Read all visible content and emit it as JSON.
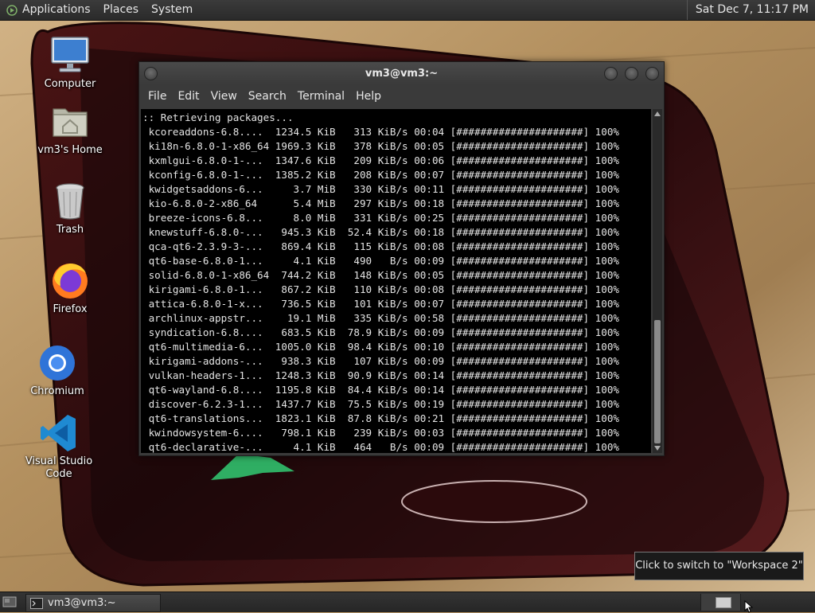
{
  "top_panel": {
    "menus": [
      "Applications",
      "Places",
      "System"
    ],
    "clock": "Sat Dec  7, 11:17 PM"
  },
  "desktop_icons": [
    {
      "label": "Computer",
      "icon": "computer-icon"
    },
    {
      "label": "vm3's Home",
      "icon": "home-folder-icon"
    },
    {
      "label": "Trash",
      "icon": "trash-icon"
    },
    {
      "label": "Firefox",
      "icon": "firefox-icon"
    },
    {
      "label": "Chromium",
      "icon": "chromium-icon"
    },
    {
      "label": "Visual Studio Code",
      "icon": "vscode-icon"
    }
  ],
  "terminal": {
    "title": "vm3@vm3:~",
    "menu": [
      "File",
      "Edit",
      "View",
      "Search",
      "Terminal",
      "Help"
    ],
    "header_line": ":: Retrieving packages...",
    "rows": [
      {
        "name": "kcoreaddons-6.8....",
        "size": "1234.5 KiB",
        "rate": "313 KiB/s",
        "time": "00:04",
        "progress": 100
      },
      {
        "name": "ki18n-6.8.0-1-x86_64",
        "size": "1969.3 KiB",
        "rate": "378 KiB/s",
        "time": "00:05",
        "progress": 100
      },
      {
        "name": "kxmlgui-6.8.0-1-...",
        "size": "1347.6 KiB",
        "rate": "209 KiB/s",
        "time": "00:06",
        "progress": 100
      },
      {
        "name": "kconfig-6.8.0-1-...",
        "size": "1385.2 KiB",
        "rate": "208 KiB/s",
        "time": "00:07",
        "progress": 100
      },
      {
        "name": "kwidgetsaddons-6...",
        "size": "3.7 MiB",
        "rate": "330 KiB/s",
        "time": "00:11",
        "progress": 100
      },
      {
        "name": "kio-6.8.0-2-x86_64",
        "size": "5.4 MiB",
        "rate": "297 KiB/s",
        "time": "00:18",
        "progress": 100
      },
      {
        "name": "breeze-icons-6.8...",
        "size": "8.0 MiB",
        "rate": "331 KiB/s",
        "time": "00:25",
        "progress": 100
      },
      {
        "name": "knewstuff-6.8.0-...",
        "size": "945.3 KiB",
        "rate": "52.4 KiB/s",
        "time": "00:18",
        "progress": 100
      },
      {
        "name": "qca-qt6-2.3.9-3-...",
        "size": "869.4 KiB",
        "rate": "115 KiB/s",
        "time": "00:08",
        "progress": 100
      },
      {
        "name": "qt6-base-6.8.0-1...",
        "size": "4.1 KiB",
        "rate": "490   B/s",
        "time": "00:09",
        "progress": 100
      },
      {
        "name": "solid-6.8.0-1-x86_64",
        "size": "744.2 KiB",
        "rate": "148 KiB/s",
        "time": "00:05",
        "progress": 100
      },
      {
        "name": "kirigami-6.8.0-1...",
        "size": "867.2 KiB",
        "rate": "110 KiB/s",
        "time": "00:08",
        "progress": 100
      },
      {
        "name": "attica-6.8.0-1-x...",
        "size": "736.5 KiB",
        "rate": "101 KiB/s",
        "time": "00:07",
        "progress": 100
      },
      {
        "name": "archlinux-appstr...",
        "size": "19.1 MiB",
        "rate": "335 KiB/s",
        "time": "00:58",
        "progress": 100
      },
      {
        "name": "syndication-6.8....",
        "size": "683.5 KiB",
        "rate": "78.9 KiB/s",
        "time": "00:09",
        "progress": 100
      },
      {
        "name": "qt6-multimedia-6...",
        "size": "1005.0 KiB",
        "rate": "98.4 KiB/s",
        "time": "00:10",
        "progress": 100
      },
      {
        "name": "kirigami-addons-...",
        "size": "938.3 KiB",
        "rate": "107 KiB/s",
        "time": "00:09",
        "progress": 100
      },
      {
        "name": "vulkan-headers-1...",
        "size": "1248.3 KiB",
        "rate": "90.9 KiB/s",
        "time": "00:14",
        "progress": 100
      },
      {
        "name": "qt6-wayland-6.8....",
        "size": "1195.8 KiB",
        "rate": "84.4 KiB/s",
        "time": "00:14",
        "progress": 100
      },
      {
        "name": "discover-6.2.3-1...",
        "size": "1437.7 KiB",
        "rate": "75.5 KiB/s",
        "time": "00:19",
        "progress": 100
      },
      {
        "name": "qt6-translations...",
        "size": "1823.1 KiB",
        "rate": "87.8 KiB/s",
        "time": "00:21",
        "progress": 100
      },
      {
        "name": "kwindowsystem-6....",
        "size": "798.1 KiB",
        "rate": "239 KiB/s",
        "time": "00:03",
        "progress": 100
      },
      {
        "name": "qt6-declarative-...",
        "size": "4.1 KiB",
        "rate": "464   B/s",
        "time": "00:09",
        "progress": 100
      }
    ]
  },
  "tooltip": "Click to switch to \"Workspace 2\"",
  "taskbar": {
    "window_label": "vm3@vm3:~"
  },
  "colors": {
    "panel": "#2e2e2e",
    "terminal_bg": "#000000",
    "terminal_fg": "#e4e4e4"
  }
}
